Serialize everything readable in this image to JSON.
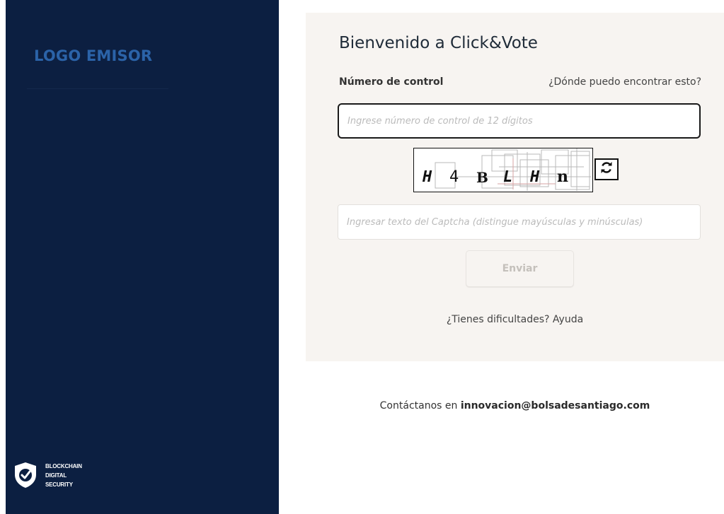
{
  "sidebar": {
    "logo_text": "LOGO EMISOR",
    "security_badge": {
      "icon": "shield-check-icon",
      "lines": [
        "BLOCKCHAIN",
        "DIGITAL",
        "SECURITY"
      ]
    }
  },
  "form": {
    "title": "Bienvenido a Click&Vote",
    "control_label": "Número de control",
    "help_link": "¿Dónde puedo encontrar esto?",
    "control_input": {
      "value": "",
      "placeholder": "Ingrese número de control de 12 dígitos"
    },
    "captcha": {
      "characters": [
        "H",
        "4",
        "B",
        "L",
        "H",
        "n"
      ],
      "refresh_icon": "refresh-icon"
    },
    "captcha_input": {
      "value": "",
      "placeholder": "Ingresar texto del Captcha (distingue mayúsculas y minúsculas)"
    },
    "submit_label": "Enviar",
    "help_text": "¿Tienes dificultades?",
    "help_action": "Ayuda"
  },
  "contact": {
    "prefix": "Contáctanos en",
    "email": "innovacion@bolsadesantiago.com"
  },
  "colors": {
    "sidebar_bg": "#0c1f41",
    "logo": "#2b63a8",
    "panel_bg": "#f7f4f1"
  }
}
